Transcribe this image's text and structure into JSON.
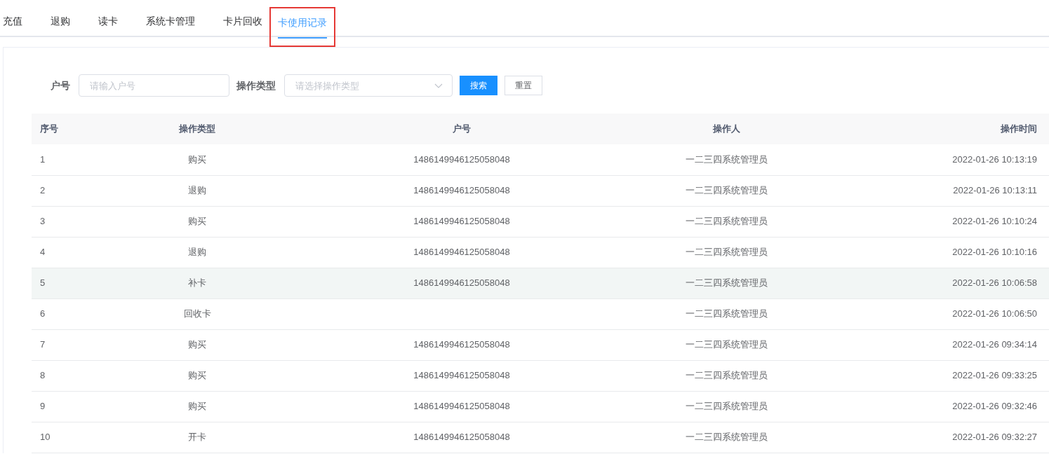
{
  "tabs": [
    {
      "label": "充值",
      "selected": false,
      "outlined": false
    },
    {
      "label": "退购",
      "selected": false,
      "outlined": false
    },
    {
      "label": "读卡",
      "selected": false,
      "outlined": false
    },
    {
      "label": "系统卡管理",
      "selected": false,
      "outlined": false
    },
    {
      "label": "卡片回收",
      "selected": false,
      "outlined": false
    },
    {
      "label": "卡使用记录",
      "selected": true,
      "outlined": true
    }
  ],
  "filters": {
    "account_label": "户号",
    "account_placeholder": "请输入户号",
    "type_label": "操作类型",
    "type_placeholder": "请选择操作类型",
    "search_button": "搜索",
    "reset_button": "重置"
  },
  "table": {
    "columns": [
      "序号",
      "操作类型",
      "户号",
      "操作人",
      "操作时间"
    ],
    "rows": [
      {
        "cells": [
          "1",
          "购买",
          "1486149946125058048",
          "一二三四系统管理员",
          "2022-01-26 10:13:19"
        ],
        "hovered": false
      },
      {
        "cells": [
          "2",
          "退购",
          "1486149946125058048",
          "一二三四系统管理员",
          "2022-01-26 10:13:11"
        ],
        "hovered": false
      },
      {
        "cells": [
          "3",
          "购买",
          "1486149946125058048",
          "一二三四系统管理员",
          "2022-01-26 10:10:24"
        ],
        "hovered": false
      },
      {
        "cells": [
          "4",
          "退购",
          "1486149946125058048",
          "一二三四系统管理员",
          "2022-01-26 10:10:16"
        ],
        "hovered": false
      },
      {
        "cells": [
          "5",
          "补卡",
          "1486149946125058048",
          "一二三四系统管理员",
          "2022-01-26 10:06:58"
        ],
        "hovered": true
      },
      {
        "cells": [
          "6",
          "回收卡",
          "",
          "一二三四系统管理员",
          "2022-01-26 10:06:50"
        ],
        "hovered": false
      },
      {
        "cells": [
          "7",
          "购买",
          "1486149946125058048",
          "一二三四系统管理员",
          "2022-01-26 09:34:14"
        ],
        "hovered": false
      },
      {
        "cells": [
          "8",
          "购买",
          "1486149946125058048",
          "一二三四系统管理员",
          "2022-01-26 09:33:25"
        ],
        "hovered": false
      },
      {
        "cells": [
          "9",
          "购买",
          "1486149946125058048",
          "一二三四系统管理员",
          "2022-01-26 09:32:46"
        ],
        "hovered": false
      },
      {
        "cells": [
          "10",
          "开卡",
          "1486149946125058048",
          "一二三四系统管理员",
          "2022-01-26 09:32:27"
        ],
        "hovered": false
      }
    ]
  }
}
